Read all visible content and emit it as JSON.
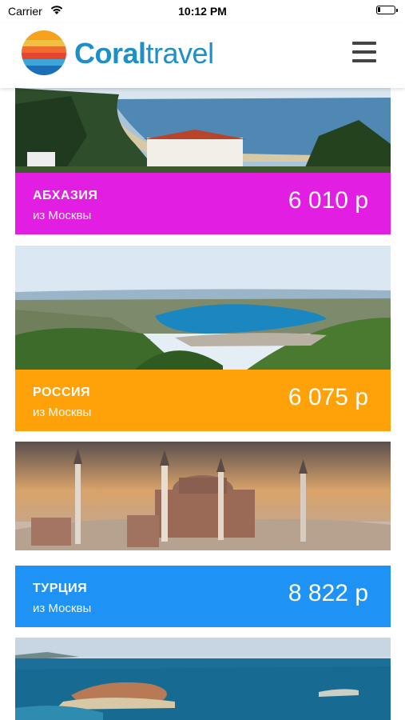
{
  "status": {
    "carrier": "Carrier",
    "time": "10:12 PM"
  },
  "header": {
    "brand_part1": "Coral",
    "brand_part2": "travel"
  },
  "colors": {
    "brand": "#1d8fc9",
    "abkhazia": "#e11ee1",
    "russia": "#ffa20a",
    "turkey": "#1f93f5"
  },
  "tours": [
    {
      "country": "АБХАЗИЯ",
      "from": "из Москвы",
      "price": "6 010 р"
    },
    {
      "country": "РОССИЯ",
      "from": "из Москвы",
      "price": "6 075 р"
    },
    {
      "country": "ТУРЦИЯ",
      "from": "из Москвы",
      "price": "8 822 р"
    }
  ]
}
